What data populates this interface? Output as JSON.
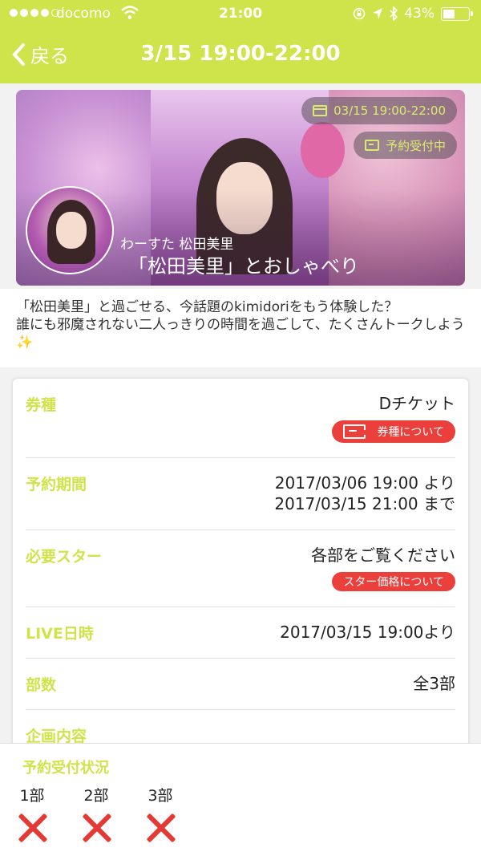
{
  "status_bar": {
    "carrier": "docomo",
    "time": "21:00",
    "battery": "43%"
  },
  "nav": {
    "back_label": "戻る",
    "title": "3/15 19:00-22:00"
  },
  "hero": {
    "date_pill": "03/15 19:00-22:00",
    "status_pill": "予約受付中",
    "subtitle": "わーすた 松田美里",
    "title": "「松田美里」とおしゃべり"
  },
  "description": {
    "line1": "「松田美里」と過ごせる、今話題のkimidoriをもう体験した？",
    "line2": "誰にも邪魔されない二人っきりの時間を過ごして、たくさんトークしよう",
    "emoji": "✨"
  },
  "details": {
    "ticket_type": {
      "label": "券種",
      "value": "Dチケット",
      "button": "券種について"
    },
    "reservation_period": {
      "label": "予約期間",
      "start": "2017/03/06 19:00 より",
      "end": "2017/03/15 21:00 まで"
    },
    "required_stars": {
      "label": "必要スター",
      "value": "各部をご覧ください",
      "button": "スター価格について"
    },
    "live_datetime": {
      "label": "LIVE日時",
      "value": "2017/03/15 19:00より"
    },
    "parts": {
      "label": "部数",
      "value": "全3部"
    },
    "plan_content": {
      "label": "企画内容"
    }
  },
  "reservation_status": {
    "title": "予約受付状況",
    "parts": [
      {
        "label": "1部",
        "status": "closed"
      },
      {
        "label": "2部",
        "status": "closed"
      },
      {
        "label": "3部",
        "status": "closed"
      }
    ]
  },
  "colors": {
    "accent": "#cfe34b",
    "button_red": "#ea3f3a",
    "closed_x": "#e53935"
  }
}
